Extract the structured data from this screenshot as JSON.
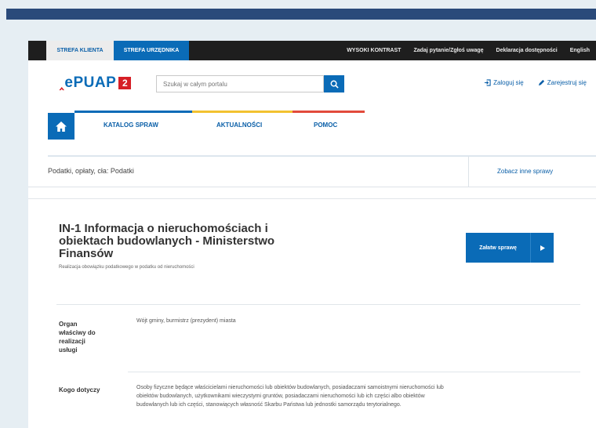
{
  "utility_bar": {
    "zone_client": "STREFA KLIENTA",
    "zone_office": "STREFA URZĘDNIKA",
    "links": [
      "WYSOKI KONTRAST",
      "Zadaj pytanie/Zgłoś uwagę",
      "Deklaracja dostępności",
      "English"
    ]
  },
  "header": {
    "logo_text": "ePUAP",
    "logo_badge": "2",
    "search_placeholder": "Szukaj w całym portalu",
    "login": "Zaloguj się",
    "register": "Zarejestruj się"
  },
  "nav": {
    "items": [
      "KATALOG SPRAW",
      "AKTUALNOŚCI",
      "POMOC"
    ]
  },
  "breadcrumb": {
    "text": "Podatki, opłaty, cła: Podatki",
    "other_link": "Zobacz inne sprawy"
  },
  "service": {
    "title_line1": "IN-1 Informacja o nieruchomościach i",
    "title_line2": "obiektach budowlanych - Ministerstwo",
    "title_line3": "Finansów",
    "subtitle": "Realizacja obowiązku podatkowego w podatku od nieruchomości",
    "action": "Załatw sprawę"
  },
  "details": [
    {
      "label_lines": [
        "Organ",
        "właściwy do",
        "realizacji",
        "usługi"
      ],
      "value_lines": [
        "Wójt gminy, burmistrz (prezydent) miasta"
      ]
    },
    {
      "label_lines": [
        "Kogo dotyczy"
      ],
      "value_lines": [
        "Osoby fizyczne będące właścicielami nieruchomości lub obiektów budowlanych, posiadaczami samoistnymi nieruchomości lub",
        "obiektów budowlanych, użytkownikami wieczystymi gruntów, posiadaczami nieruchomości lub ich części albo obiektów",
        "budowlanych lub ich części, stanowiących własność Skarbu Państwa lub jednostki samorządu terytorialnego."
      ]
    }
  ],
  "colors": {
    "brand_blue": "#0a6bb7",
    "brand_red": "#d61f26",
    "nav_accent_blue": "#0a6bb7",
    "nav_accent_yellow": "#f2c230",
    "nav_accent_red": "#e24a3b"
  }
}
